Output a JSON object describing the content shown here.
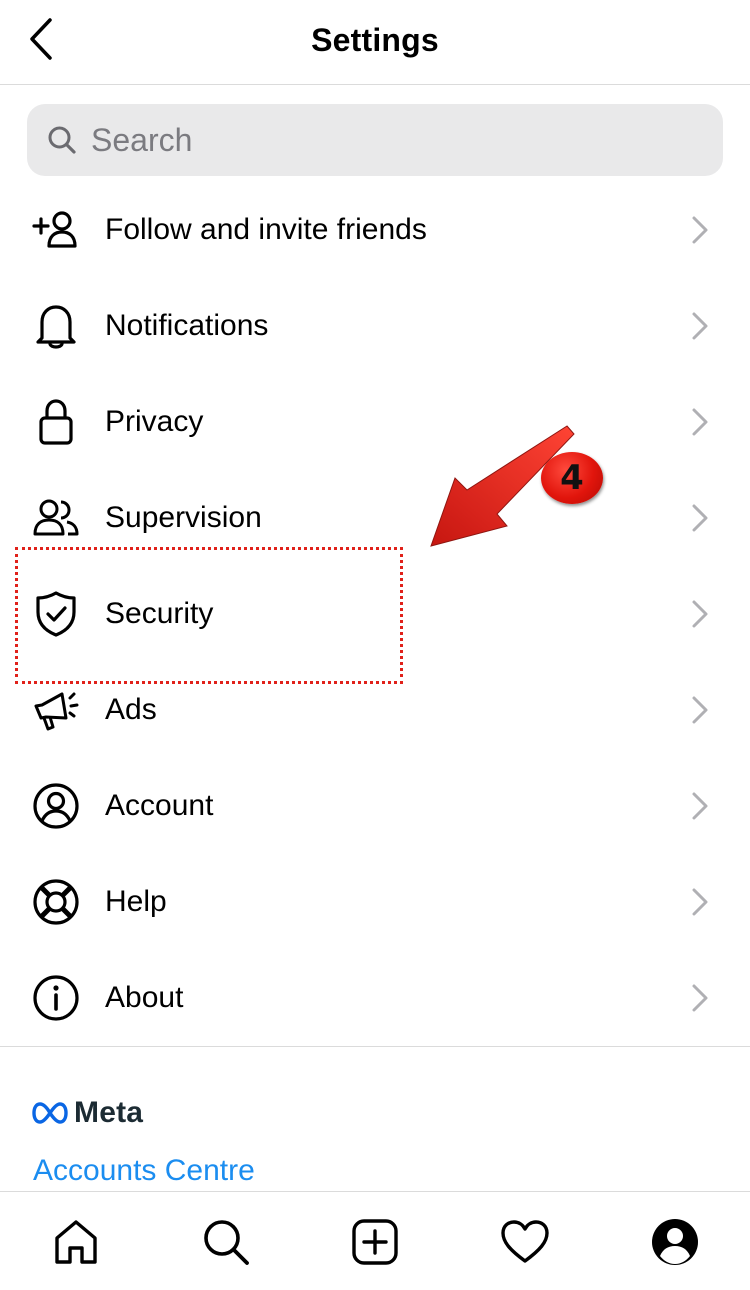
{
  "header": {
    "title": "Settings"
  },
  "search": {
    "placeholder": "Search"
  },
  "menu": {
    "items": [
      {
        "label": "Follow and invite friends",
        "icon": "add-user-icon"
      },
      {
        "label": "Notifications",
        "icon": "bell-icon"
      },
      {
        "label": "Privacy",
        "icon": "lock-icon"
      },
      {
        "label": "Supervision",
        "icon": "people-icon"
      },
      {
        "label": "Security",
        "icon": "shield-check-icon"
      },
      {
        "label": "Ads",
        "icon": "megaphone-icon"
      },
      {
        "label": "Account",
        "icon": "user-circle-icon"
      },
      {
        "label": "Help",
        "icon": "lifebuoy-icon"
      },
      {
        "label": "About",
        "icon": "info-icon"
      }
    ]
  },
  "meta": {
    "logo_text": "Meta",
    "accounts_link": "Accounts Centre"
  },
  "annotation": {
    "step_number": "4",
    "highlight_color": "#e0211a"
  },
  "colors": {
    "link": "#1b8df0",
    "search_bg": "#e9e9ea",
    "divider": "#dbdbdb",
    "chevron": "#b0b0b4"
  },
  "tabbar": {
    "tabs": [
      "home-icon",
      "search-icon",
      "create-icon",
      "heart-icon",
      "profile-icon"
    ]
  }
}
